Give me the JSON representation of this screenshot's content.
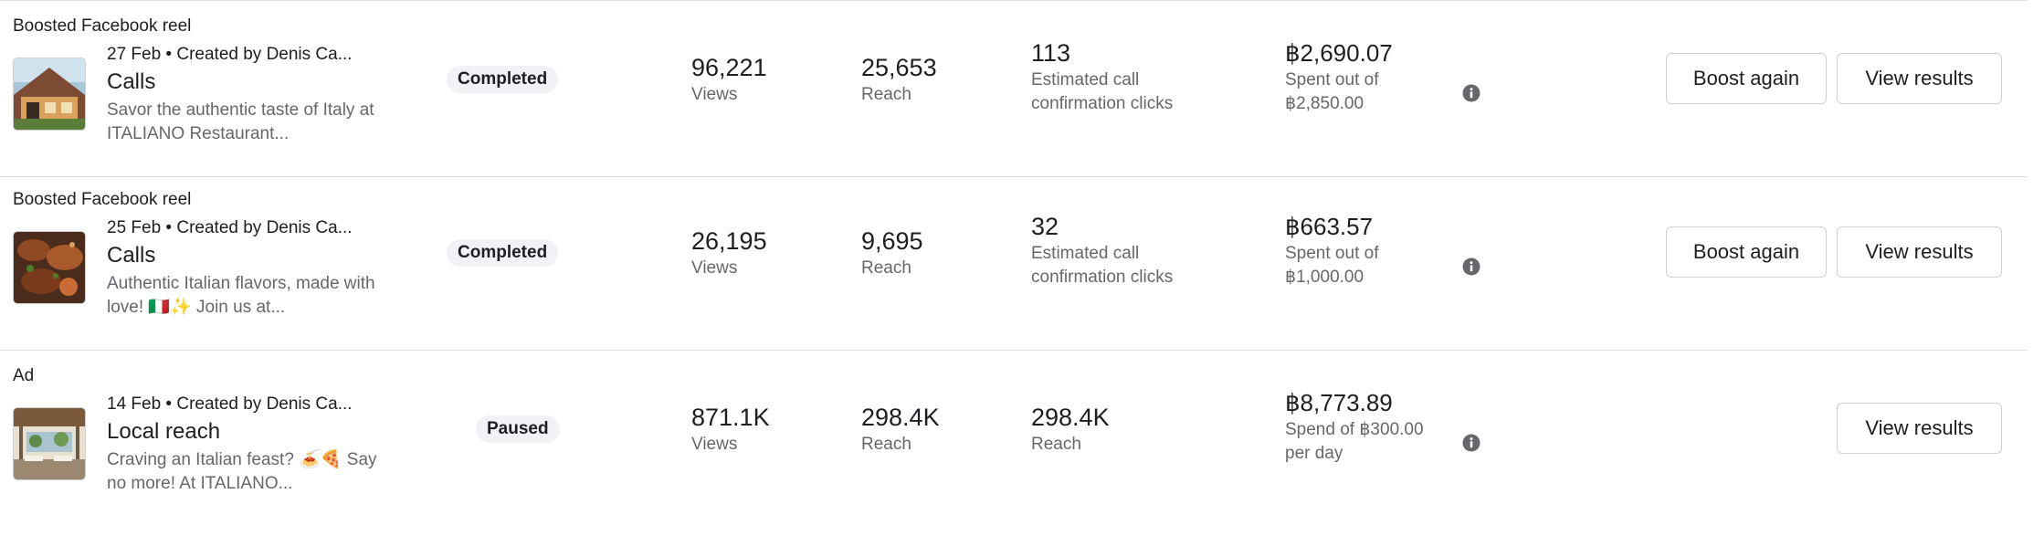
{
  "rows": [
    {
      "type_label": "Boosted Facebook reel",
      "meta": "27 Feb • Created by Denis Ca...",
      "title": "Calls",
      "description": "Savor the authentic taste of Italy at ITALIANO Restaurant...",
      "status": "Completed",
      "metrics": [
        {
          "value": "96,221",
          "label": "Views"
        },
        {
          "value": "25,653",
          "label": "Reach"
        },
        {
          "value": "113",
          "label": "Estimated call confirmation clicks"
        }
      ],
      "spend": {
        "amount": "฿2,690.07",
        "label": "Spent out of ฿2,850.00"
      },
      "boost_label": "Boost again",
      "view_label": "View results"
    },
    {
      "type_label": "Boosted Facebook reel",
      "meta": "25 Feb • Created by Denis Ca...",
      "title": "Calls",
      "description": "Authentic Italian flavors, made with love! 🇮🇹✨ Join us at...",
      "status": "Completed",
      "metrics": [
        {
          "value": "26,195",
          "label": "Views"
        },
        {
          "value": "9,695",
          "label": "Reach"
        },
        {
          "value": "32",
          "label": "Estimated call confirmation clicks"
        }
      ],
      "spend": {
        "amount": "฿663.57",
        "label": "Spent out of ฿1,000.00"
      },
      "boost_label": "Boost again",
      "view_label": "View results"
    },
    {
      "type_label": "Ad",
      "meta": "14 Feb • Created by Denis Ca...",
      "title": "Local reach",
      "description": "Craving an Italian feast? 🍝🍕 Say no more! At ITALIANO...",
      "status": "Paused",
      "metrics": [
        {
          "value": "871.1K",
          "label": "Views"
        },
        {
          "value": "298.4K",
          "label": "Reach"
        },
        {
          "value": "298.4K",
          "label": "Reach"
        }
      ],
      "spend": {
        "amount": "฿8,773.89",
        "label": "Spend of ฿300.00 per day"
      },
      "view_label": "View results"
    }
  ],
  "colors": {
    "divider": "#dadde1",
    "secondary_text": "#65676b",
    "badge_bg": "#f0f2f5",
    "button_border": "#ccd0d5"
  },
  "icons": [
    "info-icon",
    "thumbnail-image"
  ]
}
